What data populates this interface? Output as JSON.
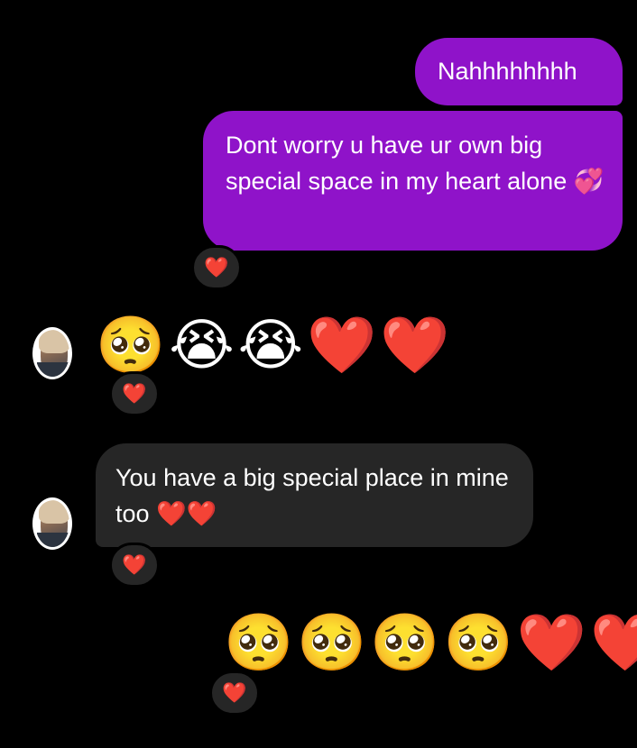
{
  "messages": {
    "out_1": {
      "text": "Nahhhhhhhh"
    },
    "out_2": {
      "text": "Dont worry u have ur own big special space  in  my heart alone",
      "emoji": "💞"
    },
    "in_emoji_row": {
      "emojis": [
        "🥺",
        "😭",
        "😭",
        "❤️",
        "❤️"
      ]
    },
    "in_text": {
      "text": "You have a big special place in mine too",
      "emoji": "❤️❤️"
    },
    "out_emoji_row": {
      "emojis": [
        "🥺",
        "🥺",
        "🥺",
        "🥺",
        "❤️",
        "❤️"
      ]
    }
  },
  "reactions": {
    "r1": "❤️",
    "r2": "❤️",
    "r3": "❤️",
    "r4": "❤️"
  },
  "colors": {
    "background": "#000000",
    "outgoing_bubble": "#8f13c9",
    "incoming_bubble": "#262626",
    "reaction_pill": "#262626",
    "heart": "#f02849"
  },
  "icons": {
    "avatar": "contact-avatar-icon",
    "heart": "heart-icon"
  }
}
